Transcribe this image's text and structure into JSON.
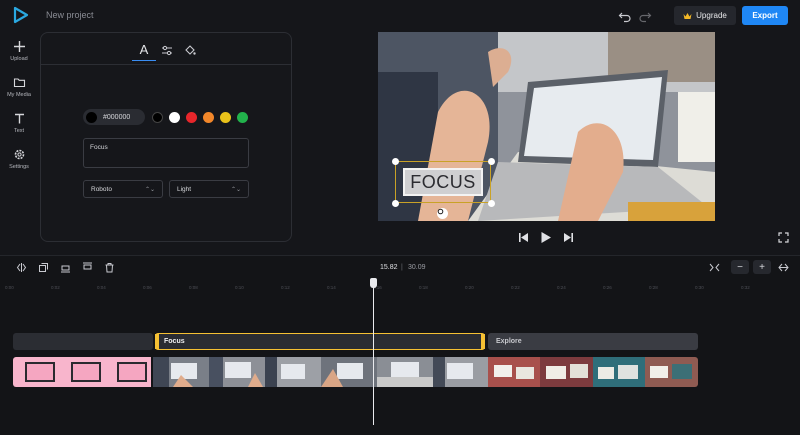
{
  "header": {
    "project_name": "New project",
    "upgrade_label": "Upgrade",
    "export_label": "Export"
  },
  "sidebar": {
    "items": [
      {
        "label": "Upload",
        "icon": "plus-icon"
      },
      {
        "label": "My Media",
        "icon": "folder-icon"
      },
      {
        "label": "Text",
        "icon": "text-icon"
      },
      {
        "label": "Settings",
        "icon": "gear-icon"
      }
    ]
  },
  "text_panel": {
    "tabs": [
      "text-icon",
      "sliders-icon",
      "fill-icon"
    ],
    "color_hex": "#000000",
    "swatches": [
      "#000000",
      "#ffffff",
      "#e8262b",
      "#f2872a",
      "#e9c21a",
      "#22b24c"
    ],
    "text_value": "Focus",
    "font_family": "Roboto",
    "font_weight": "Light"
  },
  "preview": {
    "overlay_text": "FOCUS"
  },
  "timeline": {
    "current_time": "15.82",
    "separator": "|",
    "total_time": "30.09",
    "ruler_ticks": [
      "0:00",
      "0:02",
      "0:04",
      "0:06",
      "0:08",
      "0:10",
      "0:12",
      "0:14",
      "0:16",
      "0:18",
      "0:20",
      "0:22",
      "0:24",
      "0:26",
      "0:28",
      "0:30",
      "0:32"
    ],
    "text_clips": [
      {
        "label": ""
      },
      {
        "label": "Focus"
      },
      {
        "label": "Explore"
      }
    ],
    "zoom_in": "+",
    "zoom_out": "−"
  },
  "colors": {
    "accent": "#1f87f5",
    "selection": "#f5c033",
    "pink_clip": "#f8b5cc"
  }
}
